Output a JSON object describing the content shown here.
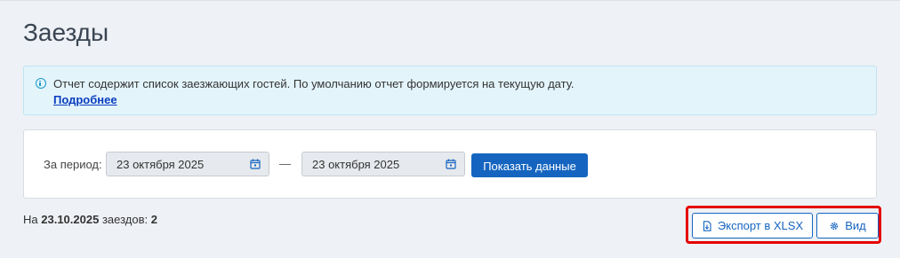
{
  "page": {
    "title": "Заезды"
  },
  "info": {
    "text": "Отчет содержит список заезжающих гостей. По умолчанию отчет формируется на текущую дату.",
    "link": "Подробнее",
    "icon": "info-icon"
  },
  "filter": {
    "period_label": "За период:",
    "date_from": "23 октября 2025",
    "date_to": "23 октября 2025",
    "separator": "—",
    "show_button": "Показать данные",
    "calendar_icon": "calendar-icon"
  },
  "summary": {
    "prefix": "На",
    "date": "23.10.2025",
    "middle": "заездов:",
    "count": "2"
  },
  "toolbar": {
    "export_label": "Экспорт в XLSX",
    "export_icon": "file-download-icon",
    "view_label": "Вид",
    "view_icon": "gear-icon"
  },
  "colors": {
    "accent": "#1565c0",
    "info_bg": "#e3f4fb",
    "highlight": "#e60000",
    "page_bg": "#eef1f5"
  }
}
